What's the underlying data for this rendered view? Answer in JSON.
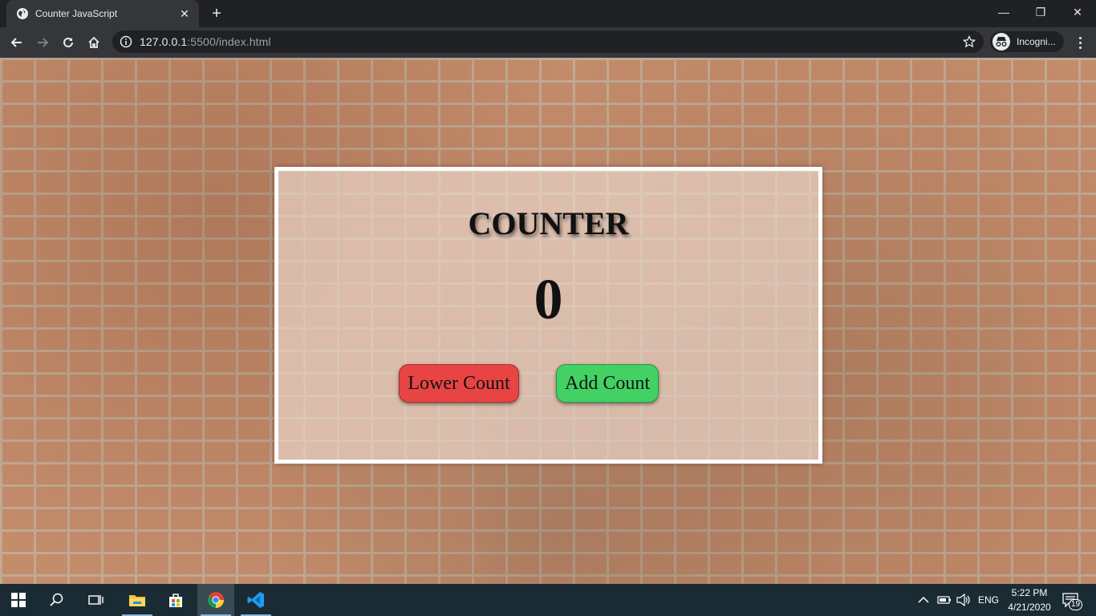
{
  "browser": {
    "tab_title": "Counter JavaScript",
    "url_host": "127.0.0.1",
    "url_rest": ":5500/index.html",
    "profile_label": "Incogni..."
  },
  "page": {
    "title": "COUNTER",
    "count": "0",
    "lower_button_label": "Lower Count",
    "add_button_label": "Add Count",
    "colors": {
      "lower_button": "#e84444",
      "add_button": "#43d164",
      "card_border": "#ffffff"
    }
  },
  "taskbar": {
    "language": "ENG",
    "time": "5:22 PM",
    "date": "4/21/2020",
    "notification_count": "19",
    "apps": [
      "start-icon",
      "search-icon",
      "task-view-icon",
      "file-explorer-icon",
      "store-icon",
      "chrome-icon",
      "vscode-icon"
    ]
  }
}
